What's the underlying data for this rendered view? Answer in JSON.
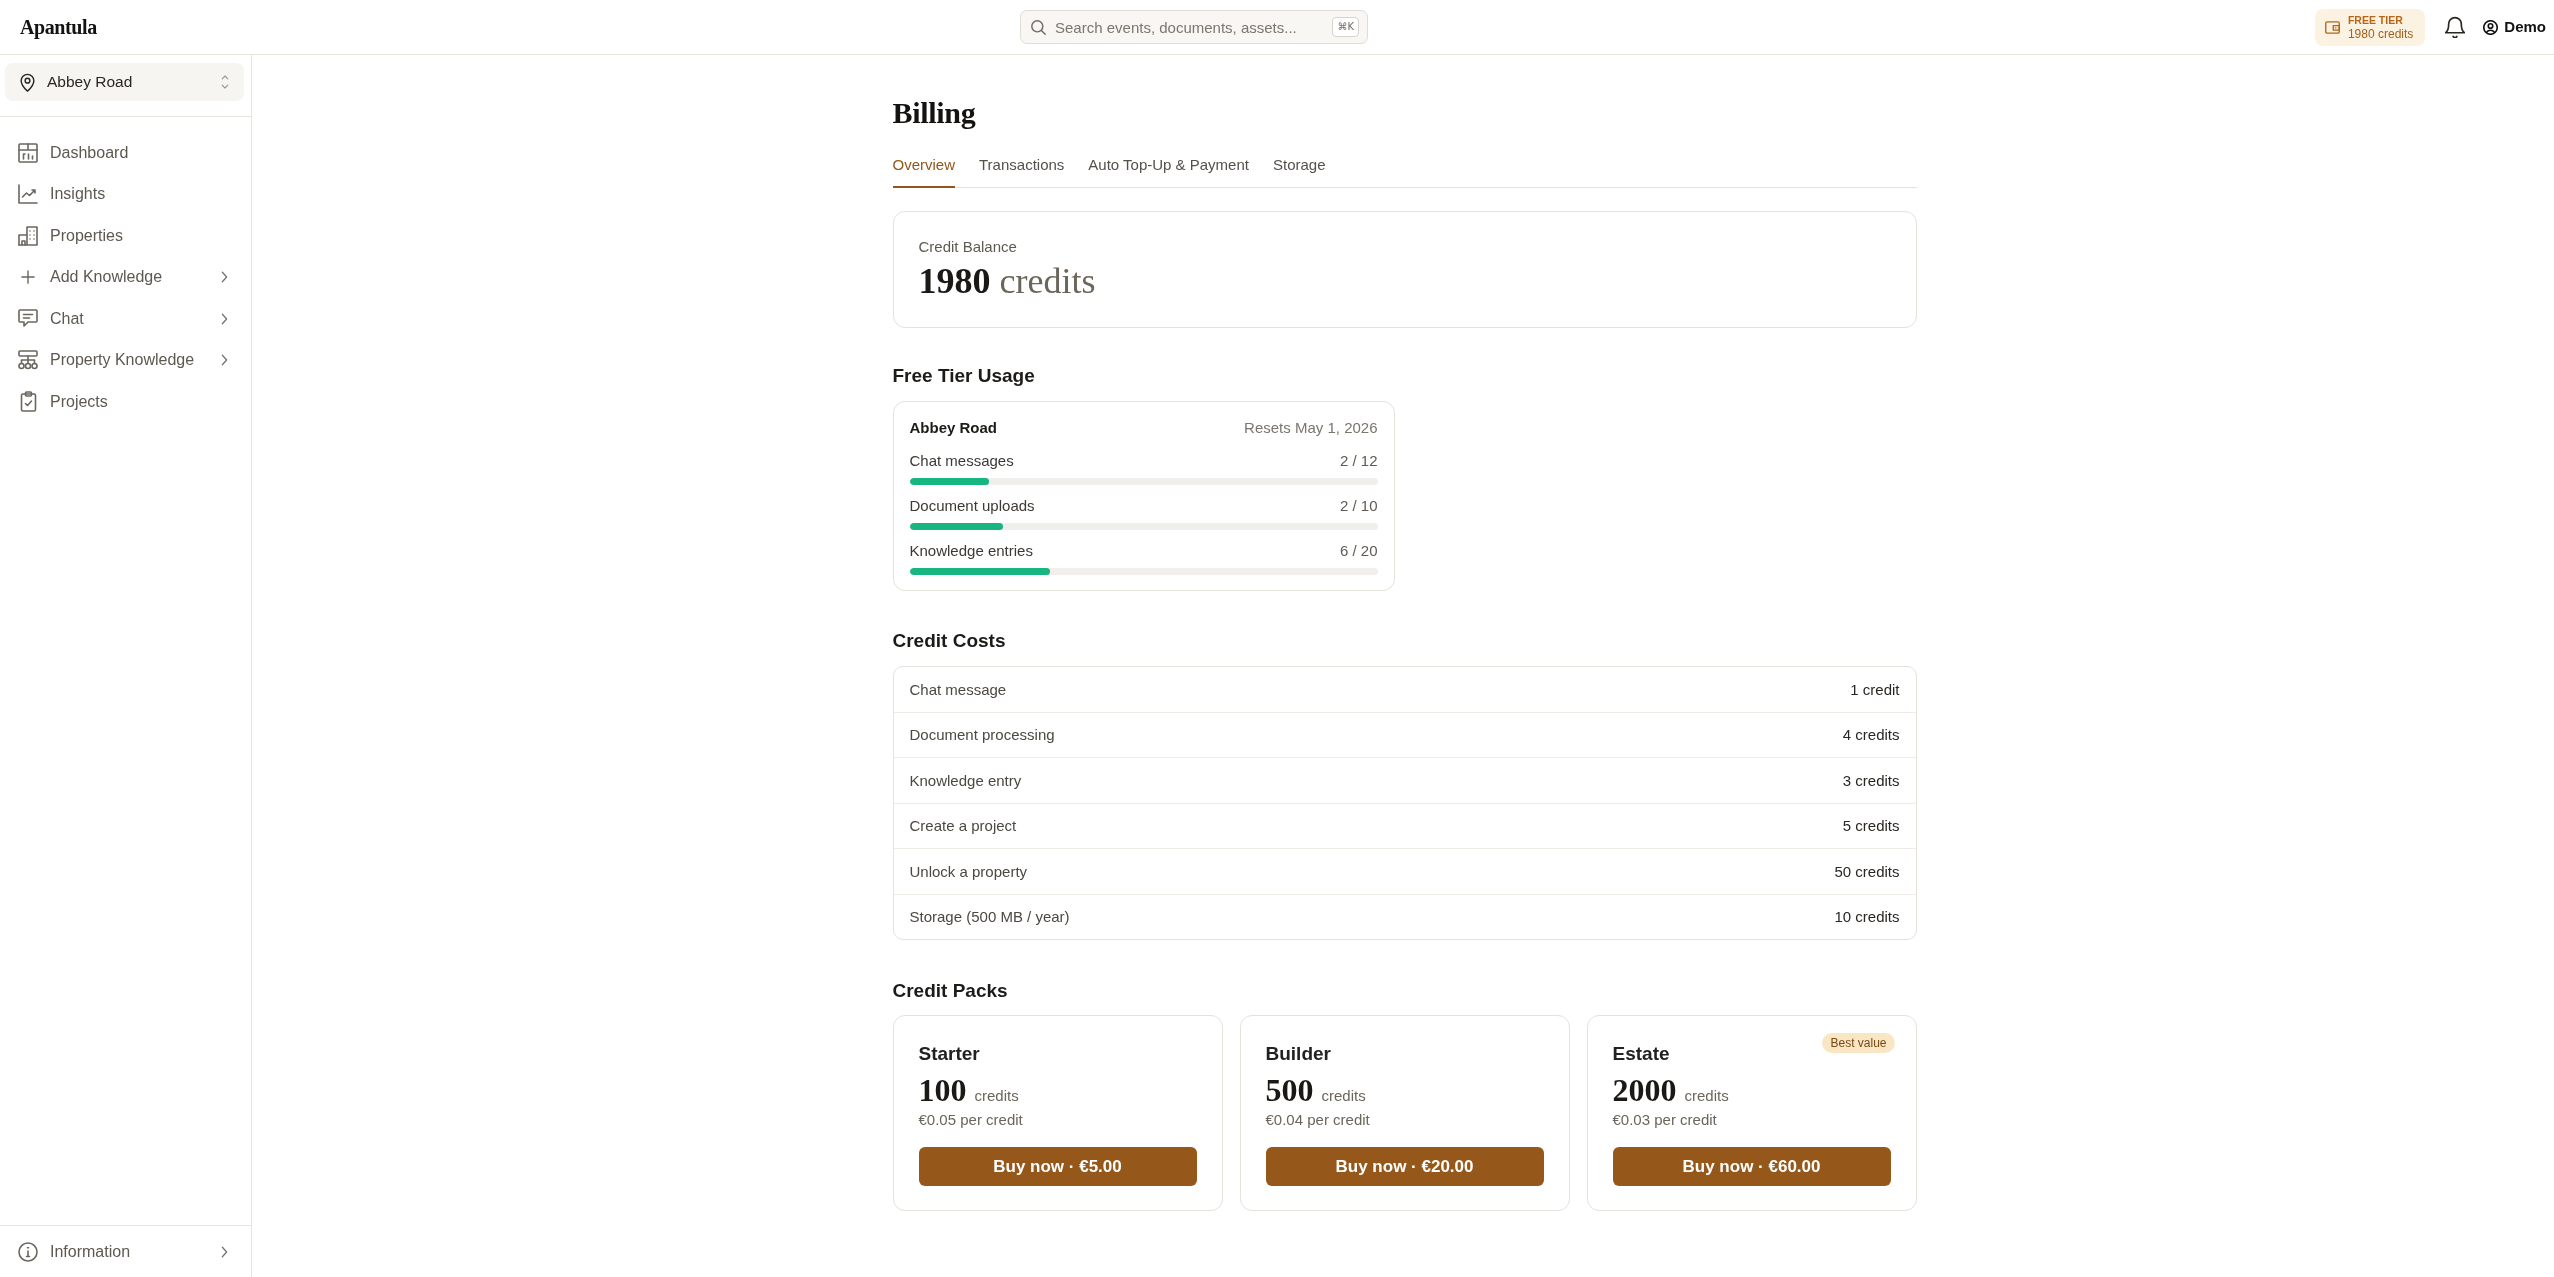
{
  "topbar": {
    "logo": "Apantula",
    "search": {
      "placeholder": "Search events, documents, assets...",
      "shortcut": "⌘K"
    },
    "plan": {
      "tier": "FREE TIER",
      "credits": "1980 credits"
    },
    "user": {
      "name": "Demo"
    }
  },
  "sidebar": {
    "location": "Abbey Road",
    "items": [
      {
        "label": "Dashboard",
        "has_submenu": false,
        "selected": false
      },
      {
        "label": "Insights",
        "has_submenu": false,
        "selected": false
      },
      {
        "label": "Properties",
        "has_submenu": false,
        "selected": false
      },
      {
        "label": "Add Knowledge",
        "has_submenu": true,
        "selected": false
      },
      {
        "label": "Chat",
        "has_submenu": true,
        "selected": false
      },
      {
        "label": "Property Knowledge",
        "has_submenu": true,
        "selected": false
      },
      {
        "label": "Projects",
        "has_submenu": false,
        "selected": false
      }
    ],
    "footer_items": [
      {
        "label": "Information",
        "has_submenu": true,
        "selected": false
      }
    ]
  },
  "page": {
    "title": "Billing"
  },
  "tabs": [
    {
      "label": "Overview",
      "selected": true
    },
    {
      "label": "Transactions",
      "selected": false
    },
    {
      "label": "Auto Top-Up & Payment",
      "selected": false
    },
    {
      "label": "Storage",
      "selected": false
    }
  ],
  "balance": {
    "label": "Credit Balance",
    "amount": "**1980** credits"
  },
  "free_tier": {
    "title": "Free Tier Usage",
    "property": "Abbey Road",
    "resets": "Resets May 1, 2026",
    "meters": [
      {
        "label": "Chat messages",
        "reading": "2 / 12",
        "level": 0.17
      },
      {
        "label": "Document uploads",
        "reading": "2 / 10",
        "level": 0.2
      },
      {
        "label": "Knowledge entries",
        "reading": "6 / 20",
        "level": 0.3
      }
    ]
  },
  "credit_costs": {
    "title": "Credit Costs",
    "rows": [
      {
        "action": "Chat message",
        "cost": "1 credit"
      },
      {
        "action": "Document processing",
        "cost": "4 credits"
      },
      {
        "action": "Knowledge entry",
        "cost": "3 credits"
      },
      {
        "action": "Create a project",
        "cost": "5 credits"
      },
      {
        "action": "Unlock a property",
        "cost": "50 credits"
      },
      {
        "action": "Storage (500 MB / year)",
        "cost": "10 credits"
      }
    ]
  },
  "credit_packs": {
    "title": "Credit Packs",
    "packs": [
      {
        "name": "Starter",
        "amount": "100",
        "unit": "credits",
        "rate": "€0.05 per credit",
        "button": "Buy now · €5.00"
      },
      {
        "name": "Builder",
        "amount": "500",
        "unit": "credits",
        "rate": "€0.04 per credit",
        "button": "Buy now · €20.00"
      },
      {
        "name": "Estate",
        "amount": "2000",
        "unit": "credits",
        "rate": "€0.03 per credit",
        "button": "Buy now · €60.00",
        "badge": "Best value"
      }
    ]
  }
}
